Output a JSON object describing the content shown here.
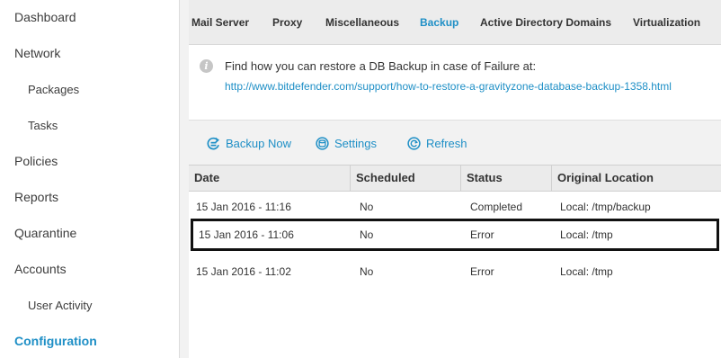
{
  "sidebar": {
    "items": [
      {
        "label": "Dashboard"
      },
      {
        "label": "Network"
      },
      {
        "label": "Packages"
      },
      {
        "label": "Tasks"
      },
      {
        "label": "Policies"
      },
      {
        "label": "Reports"
      },
      {
        "label": "Quarantine"
      },
      {
        "label": "Accounts"
      },
      {
        "label": "User Activity"
      },
      {
        "label": "Configuration"
      }
    ],
    "active": "Configuration"
  },
  "tabs": [
    {
      "label": "Mail Server"
    },
    {
      "label": "Proxy"
    },
    {
      "label": "Miscellaneous"
    },
    {
      "label": "Backup"
    },
    {
      "label": "Active Directory Domains"
    },
    {
      "label": "Virtualization"
    }
  ],
  "active_tab": "Backup",
  "info": {
    "icon": "info-icon",
    "text": "Find how you can restore a DB Backup in case of Failure at:",
    "link": "http://www.bitdefender.com/support/how-to-restore-a-gravityzone-database-backup-1358.html"
  },
  "toolbar": {
    "backup_now": "Backup Now",
    "settings": "Settings",
    "refresh": "Refresh"
  },
  "table": {
    "columns": [
      "Date",
      "Scheduled",
      "Status",
      "Original Location"
    ],
    "rows": [
      {
        "date": "15 Jan 2016 - 11:16",
        "scheduled": "No",
        "status": "Completed",
        "location": "Local: /tmp/backup"
      },
      {
        "date": "15 Jan 2016 - 11:06",
        "scheduled": "No",
        "status": "Error",
        "location": "Local: /tmp"
      },
      {
        "date": "15 Jan 2016 - 11:02",
        "scheduled": "No",
        "status": "Error",
        "location": "Local: /tmp"
      }
    ],
    "selected_row": 2
  },
  "colors": {
    "accent": "#1e8fc6",
    "text": "#333333",
    "tab_bar": "#ececec",
    "toolbar": "#f2f2f2"
  }
}
